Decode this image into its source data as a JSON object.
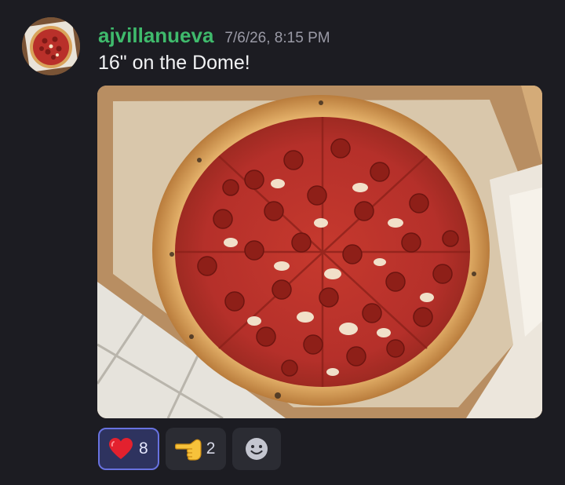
{
  "message": {
    "author": {
      "username": "ajvillanueva",
      "avatar": "pizza-avatar",
      "name_color": "#3fba6c"
    },
    "timestamp": "7/6/26, 8:15 PM",
    "content": "16\" on the Dome!",
    "attachment": {
      "type": "image",
      "subject": "pepperoni pizza in box"
    },
    "reactions": [
      {
        "emoji": "red-heart-icon",
        "count": "8",
        "reacted_by_me": true
      },
      {
        "emoji": "backhand-index-pointing-left-icon",
        "count": "2",
        "reacted_by_me": false
      }
    ],
    "add_reaction": {
      "icon": "smiley-face-icon"
    }
  },
  "colors": {
    "background": "#1c1c22",
    "accent": "#6872e0",
    "text": "#f2f3f5",
    "muted": "#9a9aa6"
  }
}
